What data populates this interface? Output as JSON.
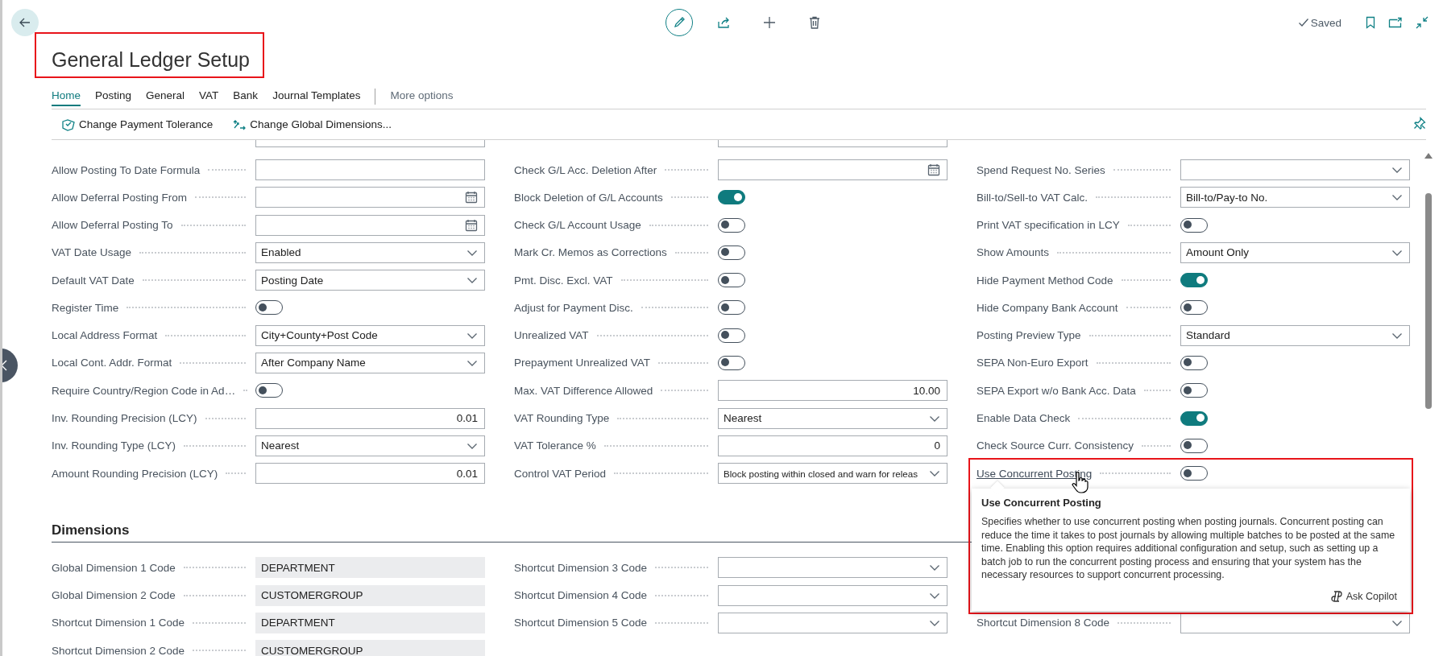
{
  "title": "General Ledger Setup",
  "status": "Saved",
  "tabs": [
    {
      "label": "Home",
      "selected": true
    },
    {
      "label": "Posting",
      "selected": false
    },
    {
      "label": "General",
      "selected": false
    },
    {
      "label": "VAT",
      "selected": false
    },
    {
      "label": "Bank",
      "selected": false
    },
    {
      "label": "Journal Templates",
      "selected": false
    }
  ],
  "more_options": "More options",
  "actions": [
    {
      "label": "Change Payment Tolerance"
    },
    {
      "label": "Change Global Dimensions..."
    }
  ],
  "general": [
    {
      "partial_field_above": true,
      "rows": [
        {
          "label": "Allow Posting To Date Formula",
          "kind": "text"
        },
        {
          "label": "Allow Deferral Posting From",
          "kind": "date"
        },
        {
          "label": "Allow Deferral Posting To",
          "kind": "date"
        },
        {
          "label": "VAT Date Usage",
          "kind": "select",
          "value": "Enabled"
        },
        {
          "label": "Default VAT Date",
          "kind": "select",
          "value": "Posting Date"
        },
        {
          "label": "Register Time",
          "kind": "toggle",
          "on": false
        },
        {
          "label": "Local Address Format",
          "kind": "select",
          "value": "City+County+Post Code"
        },
        {
          "label": "Local Cont. Addr. Format",
          "kind": "select",
          "value": "After Company Name"
        },
        {
          "label": "Require Country/Region Code in Ad…",
          "kind": "toggle",
          "on": false
        },
        {
          "label": "Inv. Rounding Precision (LCY)",
          "kind": "number",
          "value": "0.01"
        },
        {
          "label": "Inv. Rounding Type (LCY)",
          "kind": "select",
          "value": "Nearest"
        },
        {
          "label": "Amount Rounding Precision (LCY)",
          "kind": "number",
          "value": "0.01"
        }
      ]
    },
    {
      "partial_field_above": true,
      "rows": [
        {
          "label": "Check G/L Acc. Deletion After",
          "kind": "date"
        },
        {
          "label": "Block Deletion of G/L Accounts",
          "kind": "toggle",
          "on": true
        },
        {
          "label": "Check G/L Account Usage",
          "kind": "toggle",
          "on": false
        },
        {
          "label": "Mark Cr. Memos as Corrections",
          "kind": "toggle",
          "on": false
        },
        {
          "label": "Pmt. Disc. Excl. VAT",
          "kind": "toggle",
          "on": false
        },
        {
          "label": "Adjust for Payment Disc.",
          "kind": "toggle",
          "on": false
        },
        {
          "label": "Unrealized VAT",
          "kind": "toggle",
          "on": false
        },
        {
          "label": "Prepayment Unrealized VAT",
          "kind": "toggle",
          "on": false
        },
        {
          "label": "Max. VAT Difference Allowed",
          "kind": "number",
          "value": "10.00"
        },
        {
          "label": "VAT Rounding Type",
          "kind": "select",
          "value": "Nearest"
        },
        {
          "label": "VAT Tolerance %",
          "kind": "number",
          "value": "0"
        },
        {
          "label": "Control VAT Period",
          "kind": "select",
          "value": "Block posting within closed and warn for releas"
        }
      ]
    },
    {
      "partial_field_above": false,
      "rows": [
        {
          "label": "Spend Request No. Series",
          "kind": "select",
          "hovered": false
        },
        {
          "label": "Bill-to/Sell-to VAT Calc.",
          "kind": "select",
          "value": "Bill-to/Pay-to No.",
          "hovered": false
        },
        {
          "label": "Print VAT specification in LCY",
          "kind": "toggle",
          "on": false,
          "hovered": false
        },
        {
          "label": "Show Amounts",
          "kind": "select",
          "value": "Amount Only",
          "hovered": false
        },
        {
          "label": "Hide Payment Method Code",
          "kind": "toggle",
          "on": true,
          "hovered": false
        },
        {
          "label": "Hide Company Bank Account",
          "kind": "toggle",
          "on": false,
          "hovered": false
        },
        {
          "label": "Posting Preview Type",
          "kind": "select",
          "value": "Standard",
          "hovered": false
        },
        {
          "label": "SEPA Non-Euro Export",
          "kind": "toggle",
          "on": false,
          "hovered": false
        },
        {
          "label": "SEPA Export w/o Bank Acc. Data",
          "kind": "toggle",
          "on": false,
          "hovered": false
        },
        {
          "label": "Enable Data Check",
          "kind": "toggle",
          "on": true,
          "hovered": false
        },
        {
          "label": "Check Source Curr. Consistency",
          "kind": "toggle",
          "on": false,
          "hovered": false
        },
        {
          "label": "Use Concurrent Posting",
          "kind": "toggle",
          "on": false,
          "hovered": true
        }
      ]
    }
  ],
  "dimensions": {
    "title": "Dimensions",
    "columns": [
      {
        "rows": [
          {
            "label": "Global Dimension 1 Code",
            "kind": "readonly",
            "value": "DEPARTMENT"
          },
          {
            "label": "Global Dimension 2 Code",
            "kind": "readonly",
            "value": "CUSTOMERGROUP"
          },
          {
            "label": "Shortcut Dimension 1 Code",
            "kind": "readonly",
            "value": "DEPARTMENT"
          },
          {
            "label": "Shortcut Dimension 2 Code",
            "kind": "readonly",
            "value": "CUSTOMERGROUP"
          }
        ]
      },
      {
        "rows": [
          {
            "label": "Shortcut Dimension 3 Code",
            "kind": "select"
          },
          {
            "label": "Shortcut Dimension 4 Code",
            "kind": "select"
          },
          {
            "label": "Shortcut Dimension 5 Code",
            "kind": "select"
          }
        ]
      },
      {
        "rows": [
          {
            "label": "Shortcut Dimension 8 Code",
            "kind": "select"
          }
        ]
      }
    ]
  },
  "tooltip": {
    "title": "Use Concurrent Posting",
    "text": "Specifies whether to use concurrent posting when posting journals. Concurrent posting can reduce the time it takes to post journals by allowing multiple batches to be posted at the same time. Enabling this option requires additional configuration and setup, such as setting up a batch job to run the concurrent posting process and ensuring that your system has the necessary resources to support concurrent processing.",
    "action": "Ask Copilot"
  }
}
